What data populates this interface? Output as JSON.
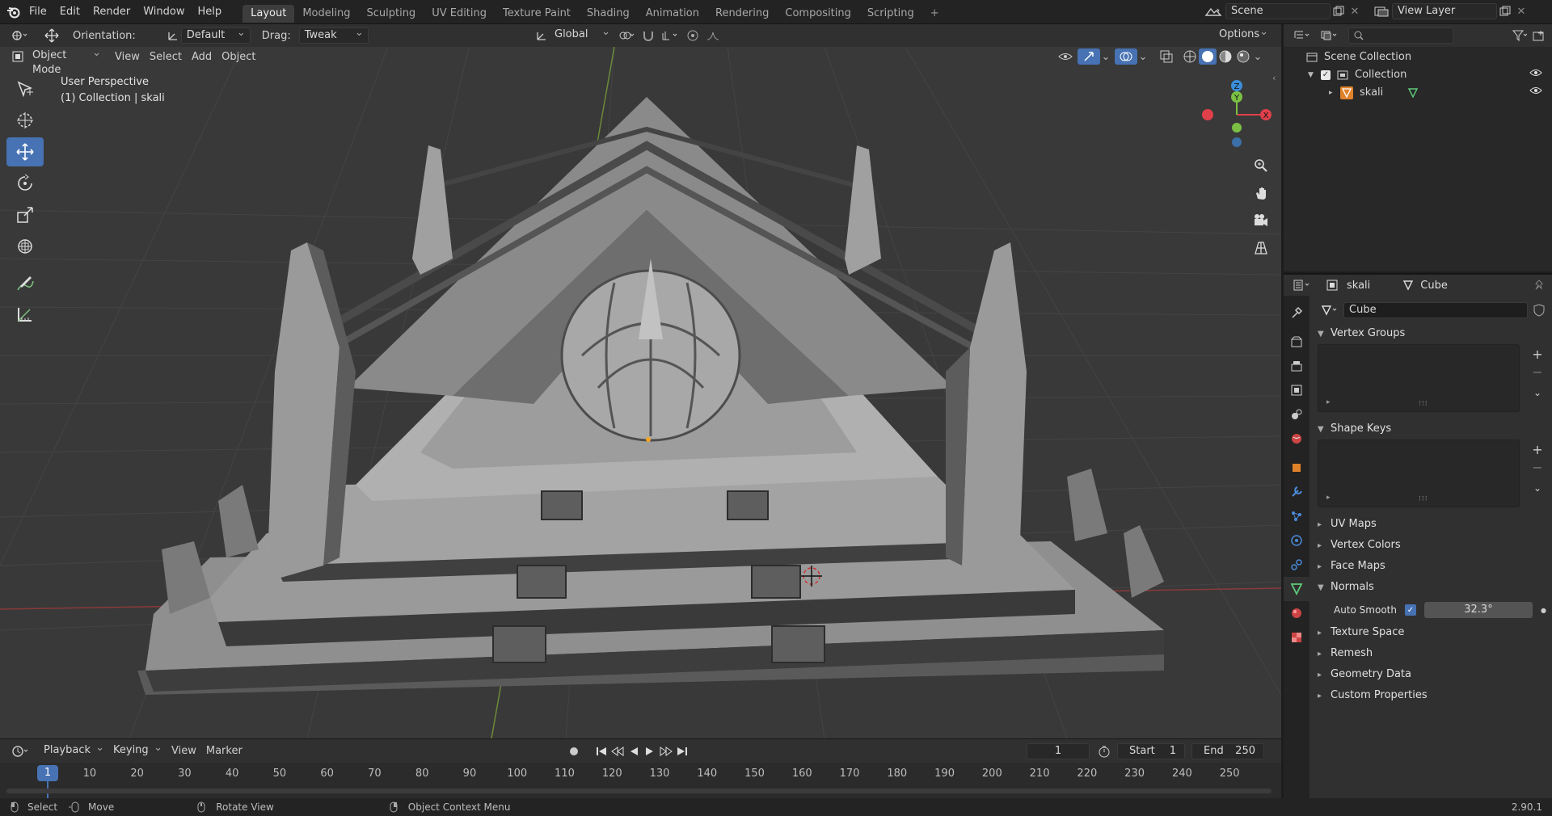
{
  "menu": {
    "items": [
      "File",
      "Edit",
      "Render",
      "Window",
      "Help"
    ]
  },
  "workspaces": {
    "tabs": [
      "Layout",
      "Modeling",
      "Sculpting",
      "UV Editing",
      "Texture Paint",
      "Shading",
      "Animation",
      "Rendering",
      "Compositing",
      "Scripting"
    ],
    "add": "+"
  },
  "scene": {
    "name": "Scene",
    "view_layer": "View Layer"
  },
  "tool_settings": {
    "orientation_label": "Orientation:",
    "orientation_value": "Default",
    "drag_label": "Drag:",
    "drag_value": "Tweak",
    "transform_orientation": "Global",
    "options": "Options"
  },
  "viewport_header": {
    "mode": "Object Mode",
    "view": "View",
    "select": "Select",
    "add": "Add",
    "object": "Object"
  },
  "viewport": {
    "perspective": "User Perspective",
    "collection_info": "(1) Collection | skali",
    "gizmo": {
      "z": "Z",
      "y": "Y",
      "x": "X"
    }
  },
  "timeline": {
    "playback": "Playback",
    "keying": "Keying",
    "view": "View",
    "marker": "Marker",
    "current_frame": "1",
    "start_label": "Start",
    "start_value": "1",
    "end_label": "End",
    "end_value": "250",
    "ruler": [
      "10",
      "20",
      "30",
      "40",
      "50",
      "60",
      "70",
      "80",
      "90",
      "100",
      "110",
      "120",
      "130",
      "140",
      "150",
      "160",
      "170",
      "180",
      "190",
      "200",
      "210",
      "220",
      "230",
      "240",
      "250"
    ],
    "current_marker": "1"
  },
  "statusbar": {
    "select": "Select",
    "move": "Move",
    "rotate": "Rotate View",
    "context": "Object Context Menu",
    "version": "2.90.1"
  },
  "outliner": {
    "scene_collection": "Scene Collection",
    "collection": "Collection",
    "object": "skali"
  },
  "properties": {
    "object_name": "skali",
    "mesh_name": "Cube",
    "datablock": "Cube",
    "panels": {
      "vertex_groups": "Vertex Groups",
      "shape_keys": "Shape Keys",
      "uv_maps": "UV Maps",
      "vertex_colors": "Vertex Colors",
      "face_maps": "Face Maps",
      "normals": "Normals",
      "auto_smooth_label": "Auto Smooth",
      "auto_smooth_angle": "32.3°",
      "texture_space": "Texture Space",
      "remesh": "Remesh",
      "geometry_data": "Geometry Data",
      "custom_properties": "Custom Properties"
    }
  },
  "colors": {
    "accent": "#4772b3",
    "x_axis": "#e0404a",
    "y_axis": "#7bc043",
    "z_axis": "#3b8fd9"
  }
}
